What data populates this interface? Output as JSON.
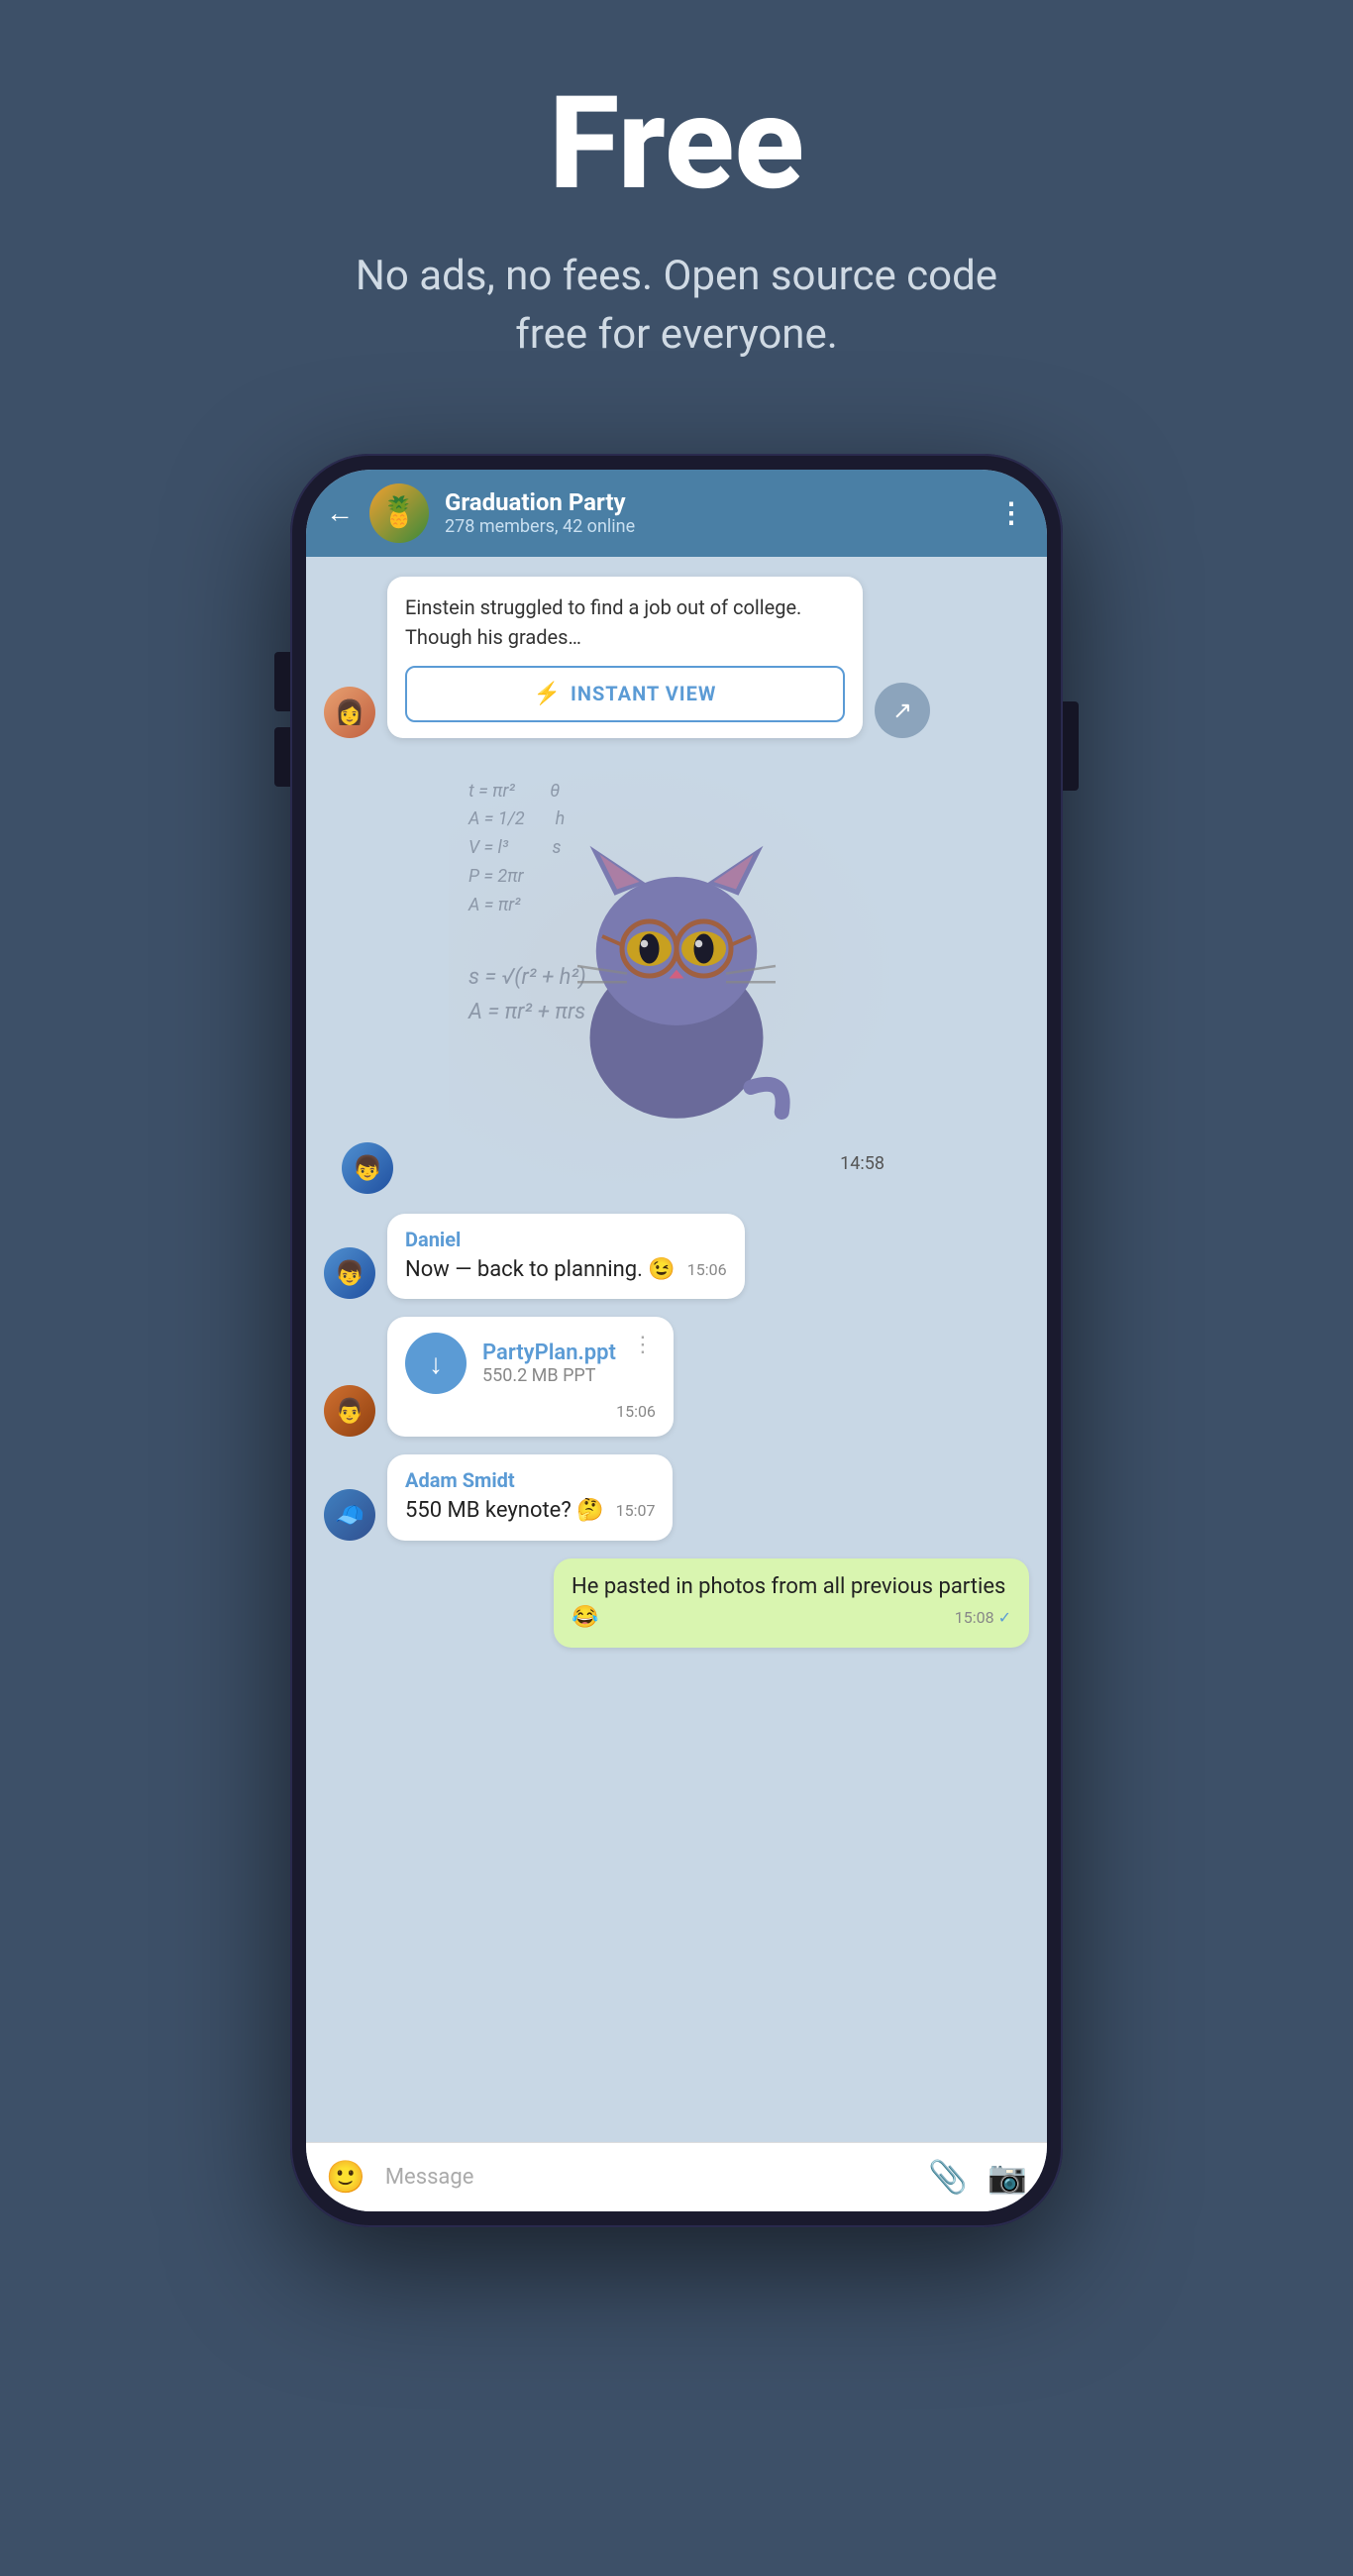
{
  "hero": {
    "title": "Free",
    "subtitle": "No ads, no fees. Open source code free for everyone."
  },
  "chat_header": {
    "back_label": "←",
    "group_name": "Graduation Party",
    "members_info": "278 members, 42 online",
    "menu_label": "⋮",
    "avatar_emoji": "🍍"
  },
  "messages": [
    {
      "id": "link-preview",
      "type": "link",
      "text": "Einstein struggled to find a job out of college. Though his grades…",
      "instant_view_label": "INSTANT VIEW",
      "avatar": "female"
    },
    {
      "id": "sticker",
      "type": "sticker",
      "time": "14:58",
      "avatar": "male1"
    },
    {
      "id": "daniel-msg",
      "type": "text",
      "sender": "Daniel",
      "text": "Now — back to planning. 😉",
      "time": "15:06",
      "avatar": "male1"
    },
    {
      "id": "file-msg",
      "type": "file",
      "file_name": "PartyPlan.ppt",
      "file_size": "550.2 MB PPT",
      "time": "15:06",
      "avatar": "male2"
    },
    {
      "id": "adam-msg",
      "type": "text",
      "sender": "Adam Smidt",
      "text": "550 MB keynote? 🤔",
      "time": "15:07",
      "avatar": "male3"
    },
    {
      "id": "own-msg",
      "type": "own",
      "text": "He pasted in photos from all previous parties 😂",
      "time": "15:08",
      "checked": true
    }
  ],
  "input_bar": {
    "placeholder": "Message",
    "emoji_icon": "😊",
    "attach_icon": "📎",
    "camera_icon": "📷"
  },
  "math_formulas": [
    "t = πr²",
    "A = 1/2",
    "V = l³",
    "P = 2πr",
    "A = πr²",
    "s = √(r²+h²)",
    "A = πr² + πrs"
  ]
}
